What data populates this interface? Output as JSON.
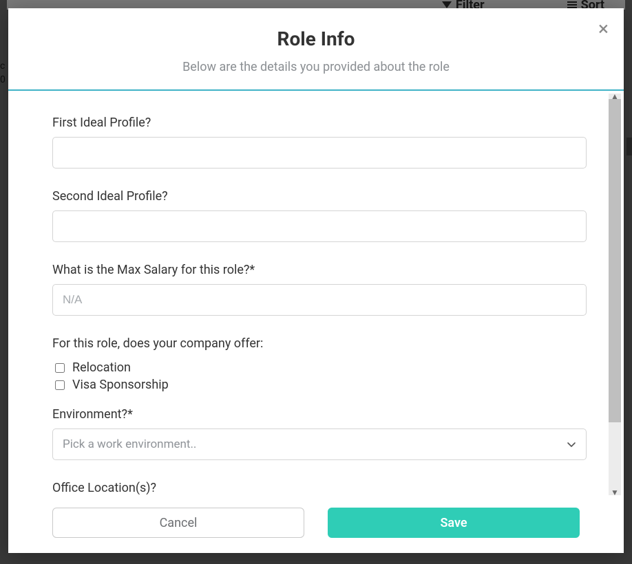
{
  "background": {
    "filter_label": "Filter",
    "sort_label": "Sort",
    "left_c": "c",
    "left_0": "0"
  },
  "modal": {
    "title": "Role Info",
    "subtitle": "Below are the details you provided about the role",
    "close_glyph": "×"
  },
  "form": {
    "first_profile": {
      "label": "First Ideal Profile?",
      "value": ""
    },
    "second_profile": {
      "label": "Second Ideal Profile?",
      "value": ""
    },
    "max_salary": {
      "label": "What is the Max Salary for this role?*",
      "placeholder": "N/A",
      "value": ""
    },
    "offers": {
      "label": "For this role, does your company offer:",
      "relocation": {
        "label": "Relocation",
        "checked": false
      },
      "visa": {
        "label": "Visa Sponsorship",
        "checked": false
      }
    },
    "environment": {
      "label": "Environment?*",
      "placeholder": "Pick a work environment..",
      "value": ""
    },
    "office_locations": {
      "label": "Office Location(s)?"
    }
  },
  "footer": {
    "cancel_label": "Cancel",
    "save_label": "Save"
  }
}
